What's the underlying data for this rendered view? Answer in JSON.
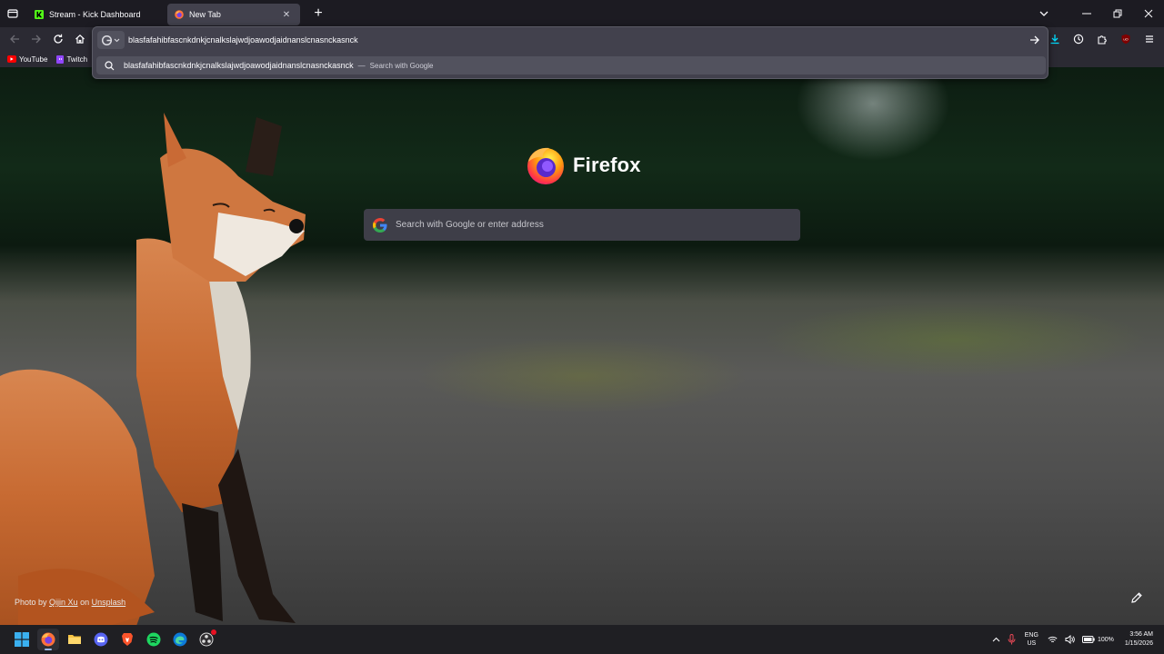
{
  "tabs": [
    {
      "title": "Stream - Kick Dashboard",
      "favicon": "kick-icon",
      "active": false
    },
    {
      "title": "New Tab",
      "favicon": "firefox-icon",
      "active": true
    }
  ],
  "urlbar": {
    "value": "blasfafahibfascnkdnkjcnalkslajwdjoawodjaidnanslcnasnckasnck",
    "suggestion_text": "blasfafahibfascnkdnkjcnalkslajwdjoawodjaidnanslcnasnckasnck",
    "suggestion_separator": "—",
    "suggestion_action": "Search with Google"
  },
  "bookmarks": [
    {
      "label": "YouTube",
      "icon": "youtube-icon",
      "color": "#ff0000"
    },
    {
      "label": "Twitch",
      "icon": "twitch-icon",
      "color": "#9146ff"
    }
  ],
  "newtab": {
    "brand": "Firefox",
    "search_placeholder": "Search with Google or enter address",
    "credit": {
      "prefix": "Photo by",
      "author": "Qijin Xu",
      "on": "on",
      "site": "Unsplash"
    }
  },
  "taskbar": {
    "apps": [
      "windows-start-icon",
      "firefox-icon",
      "file-explorer-icon",
      "discord-icon",
      "brave-icon",
      "spotify-icon",
      "edge-icon",
      "obs-icon"
    ],
    "language": {
      "line1": "ENG",
      "line2": "US"
    },
    "battery": "100%",
    "time": "3:56 AM",
    "date": "1/15/2026"
  },
  "colors": {
    "accent": "#00ddff",
    "active_tab": "#42414d",
    "toolbar": "#2b2a33",
    "titlebar": "#1c1b22",
    "kick_green": "#53fc18"
  }
}
